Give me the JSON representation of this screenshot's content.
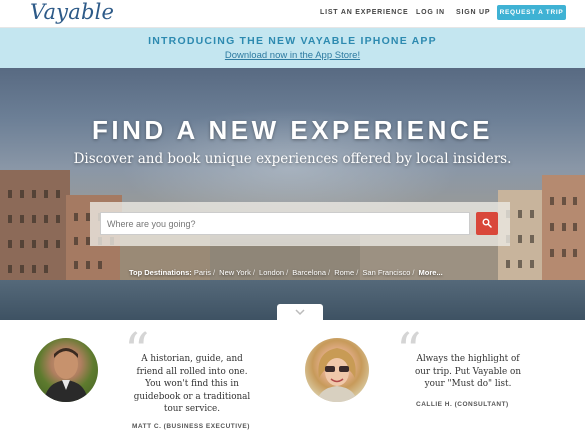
{
  "header": {
    "logo": "Vayable",
    "nav": {
      "list_experience": "LIST AN EXPERIENCE",
      "login": "LOG IN",
      "signup": "SIGN UP",
      "request_trip": "REQUEST A TRIP"
    }
  },
  "banner": {
    "title": "INTRODUCING THE NEW VAYABLE IPHONE APP",
    "link": "Download now in the App Store!"
  },
  "hero": {
    "title": "FIND A NEW EXPERIENCE",
    "subtitle": "Discover and book unique experiences offered by local insiders.",
    "search": {
      "placeholder": "Where are you going?",
      "button_icon": "search-icon"
    },
    "destinations": {
      "label": "Top Destinations:",
      "items": [
        "Paris",
        "New York",
        "London",
        "Barcelona",
        "Rome",
        "San Francisco"
      ],
      "more": "More..."
    },
    "scroll_icon": "chevron-down-icon"
  },
  "testimonials": [
    {
      "quote": "A historian, guide, and friend all rolled into one. You won't find this in guidebook or a traditional tour service.",
      "author": "MATT C. (BUSINESS EXECUTIVE)"
    },
    {
      "quote": "Always the highlight of our trip. Put Vayable on your \"Must do\" list.",
      "author": "CALLIE H. (CONSULTANT)"
    }
  ],
  "colors": {
    "accent": "#3fb2d4",
    "brand": "#2d5a88",
    "banner_bg": "#c4e6f0",
    "search_button": "#d9473a"
  }
}
